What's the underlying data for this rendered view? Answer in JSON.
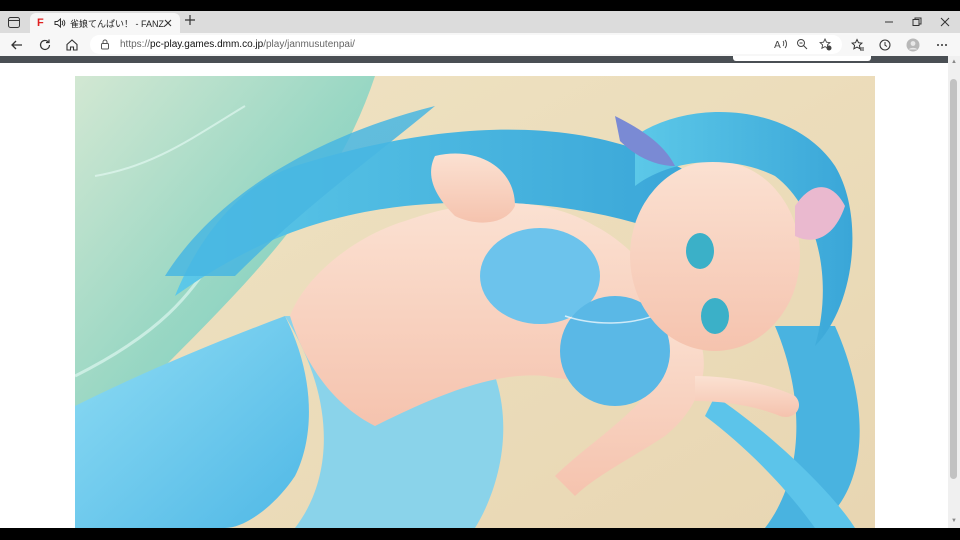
{
  "browser": {
    "tab": {
      "favicon": "F",
      "title": "雀娘てんぱい！ - FANZA GAMES",
      "audio_icon": "speaker-icon"
    },
    "url": {
      "scheme": "https://",
      "host": "pc-play.games.dmm.co.jp",
      "path": "/play/janmusutenpai/"
    },
    "colors": {
      "favicon_red": "#e02020",
      "tabstrip": "#dcdcdc",
      "toolbar": "#f7f7f7"
    }
  },
  "game": {
    "scene": "game-canvas"
  }
}
